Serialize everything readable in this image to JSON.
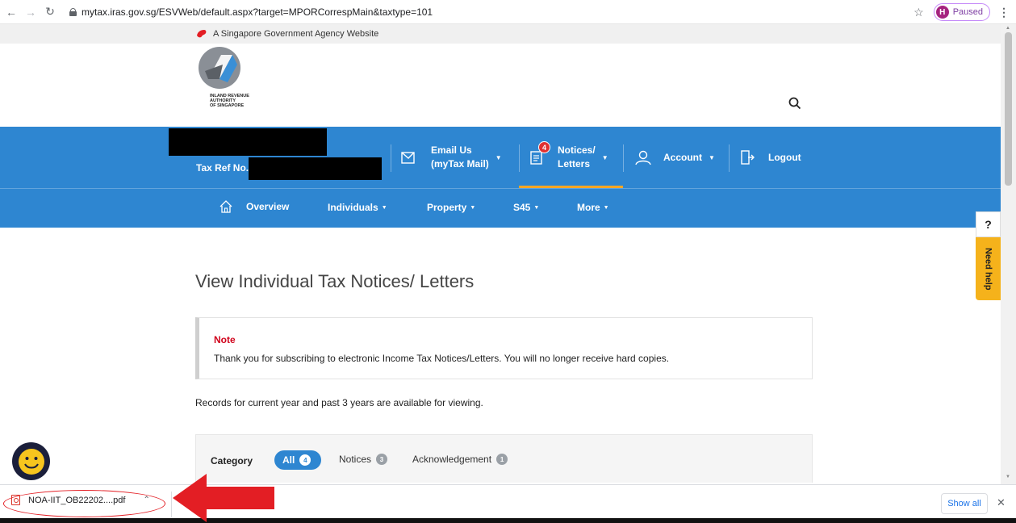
{
  "browser": {
    "url": "mytax.iras.gov.sg/ESVWeb/default.aspx?target=MPORCorrespMain&taxtype=101",
    "profile_initial": "H",
    "profile_status": "Paused"
  },
  "gov_banner": {
    "text": "A Singapore Government Agency Website"
  },
  "logo": {
    "line1": "INLAND REVENUE",
    "line2": "AUTHORITY",
    "line3": "OF SINGAPORE"
  },
  "topbar": {
    "tax_ref_label": "Tax Ref No.",
    "email_line1": "Email Us",
    "email_line2": "(myTax Mail)",
    "notices_line1": "Notices/",
    "notices_line2": "Letters",
    "notices_badge": "4",
    "account": "Account",
    "logout": "Logout"
  },
  "subnav": {
    "overview": "Overview",
    "individuals": "Individuals",
    "property": "Property",
    "s45": "S45",
    "more": "More"
  },
  "help": {
    "question_mark": "?",
    "label": "Need help"
  },
  "main": {
    "title": "View Individual Tax Notices/ Letters",
    "note_title": "Note",
    "note_text": "Thank you for subscribing to electronic Income Tax Notices/Letters. You will no longer receive hard copies.",
    "records_text": "Records for current year and past 3 years are available for viewing.",
    "category_label": "Category",
    "categories": [
      {
        "label": "All",
        "count": "4",
        "selected": true
      },
      {
        "label": "Notices",
        "count": "3",
        "selected": false
      },
      {
        "label": "Acknowledgement",
        "count": "1",
        "selected": false
      }
    ]
  },
  "download_bar": {
    "file_name": "NOA-IIT_OB22202....pdf",
    "show_all": "Show all"
  },
  "colors": {
    "brand_blue": "#2e86d1",
    "active_tab": "#f5a623",
    "help_tab": "#f5b21b",
    "note_red": "#d0021b",
    "annotation_red": "#e31e24"
  }
}
